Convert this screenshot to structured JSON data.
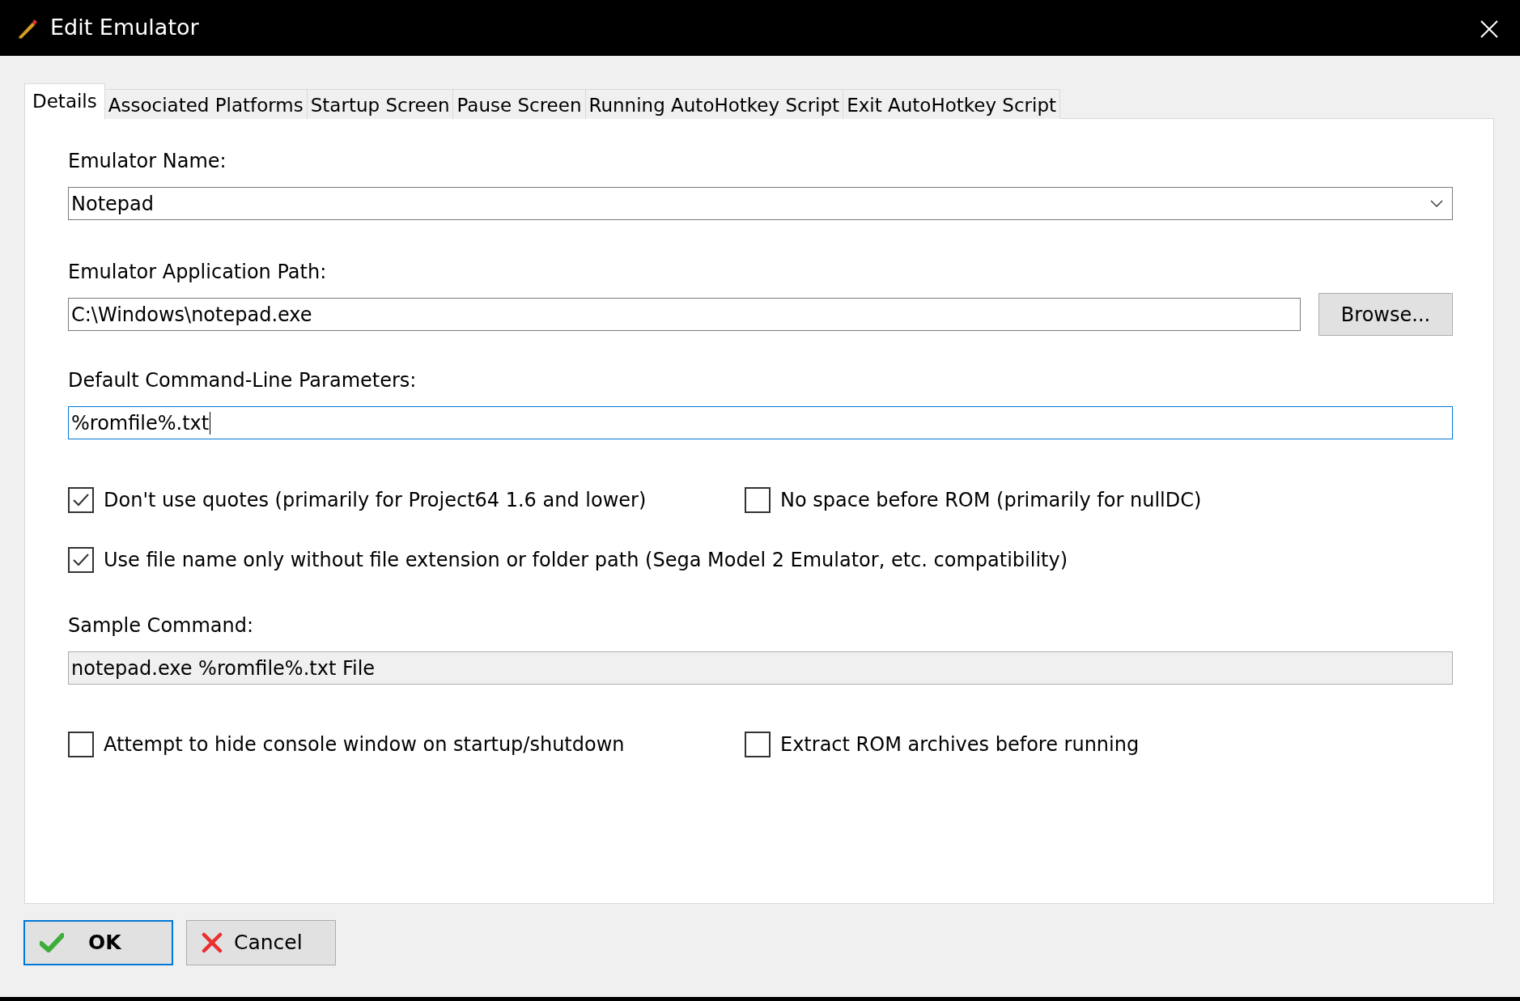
{
  "window": {
    "title": "Edit Emulator"
  },
  "tabs": [
    {
      "label": "Details",
      "selected": true
    },
    {
      "label": "Associated Platforms",
      "selected": false
    },
    {
      "label": "Startup Screen",
      "selected": false
    },
    {
      "label": "Pause Screen",
      "selected": false
    },
    {
      "label": "Running AutoHotkey Script",
      "selected": false
    },
    {
      "label": "Exit AutoHotkey Script",
      "selected": false
    }
  ],
  "emulator_name": {
    "label": "Emulator Name:",
    "value": "Notepad"
  },
  "application_path": {
    "label": "Emulator Application Path:",
    "value": "C:\\Windows\\notepad.exe",
    "button": "Browse..."
  },
  "command_line_parameters": {
    "label": "Default Command-Line Parameters:",
    "value": "%romfile%.txt",
    "focused": true
  },
  "options": [
    [
      {
        "label": "Don't use quotes (primarily for Project64 1.6 and lower)",
        "checked": true
      },
      {
        "label": "No space before ROM (primarily for nullDC)",
        "checked": false
      }
    ],
    [
      {
        "label": "Use file name only without file extension or folder path (Sega Model 2 Emulator, etc. compatibility)",
        "checked": true
      }
    ]
  ],
  "sample_command": {
    "label": "Sample Command:",
    "value": "notepad.exe %romfile%.txt File"
  },
  "more_options": [
    [
      {
        "label": "Attempt to hide console window on startup/shutdown",
        "checked": false
      },
      {
        "label": "Extract ROM archives before running",
        "checked": false
      }
    ]
  ],
  "buttons": [
    {
      "label": "OK",
      "kind": "ok",
      "default": true
    },
    {
      "label": "Cancel",
      "kind": "cancel",
      "default": false
    }
  ]
}
